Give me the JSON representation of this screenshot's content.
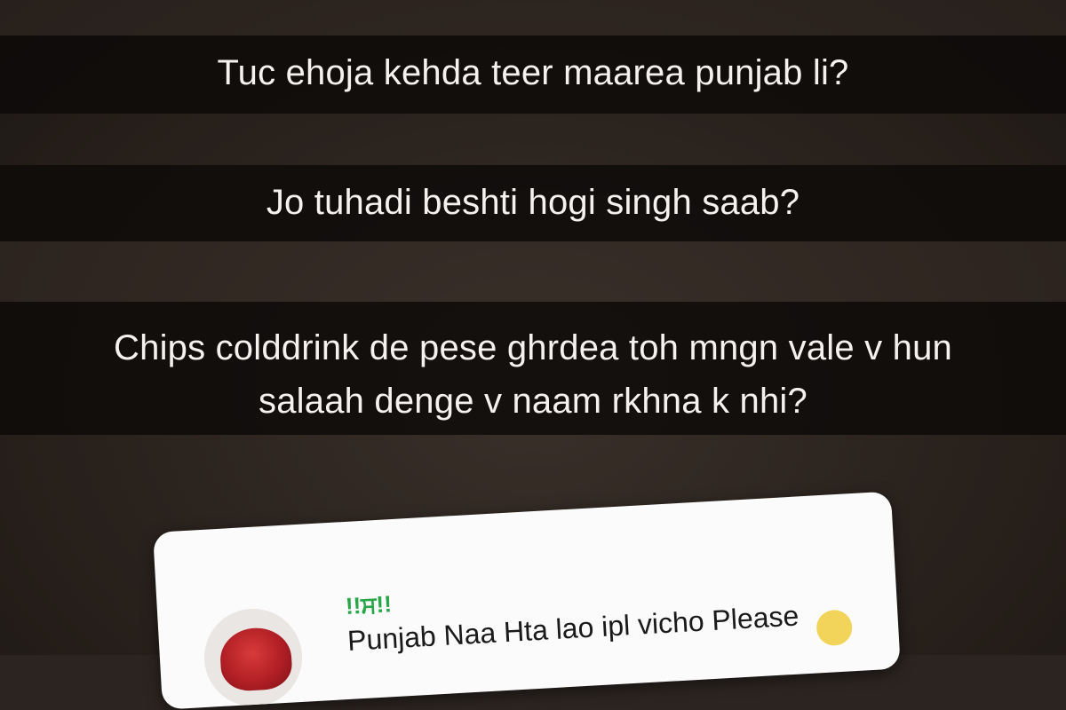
{
  "captions": {
    "line1": "Tuc ehoja kehda teer maarea punjab li?",
    "line2": "Jo tuhadi beshti hogi singh saab?",
    "line3a": "Chips colddrink de pese ghrdea toh mngn vale v hun",
    "line3b": "salaah denge v naam rkhna k nhi?"
  },
  "comment_card": {
    "username": "!!ਸ!!",
    "message": "Punjab Naa Hta lao ipl vicho Please",
    "avatar_icon": "turban-avatar-icon",
    "username_color": "#2aa64a"
  }
}
